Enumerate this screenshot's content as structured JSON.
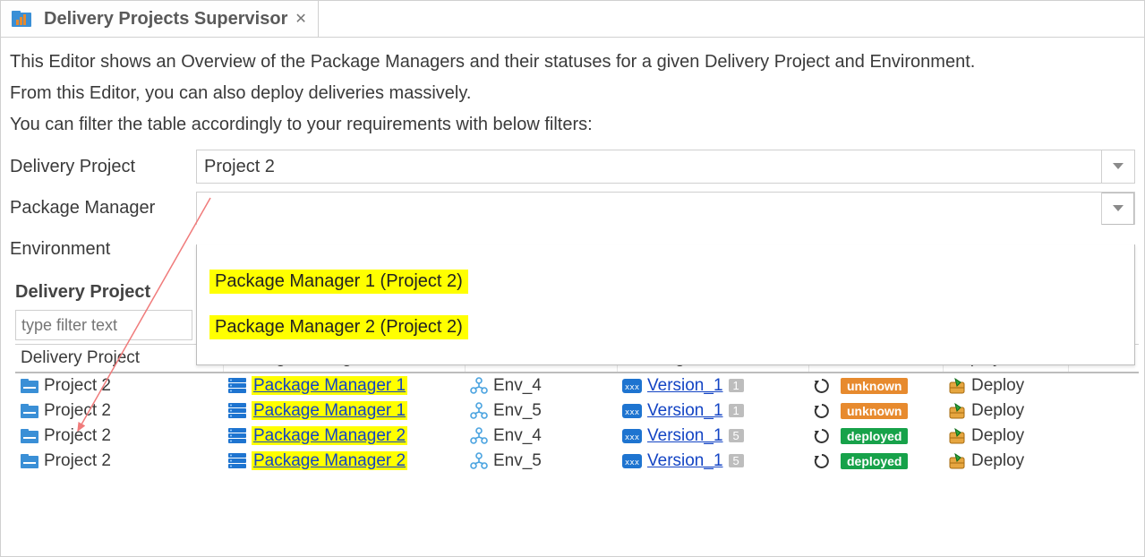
{
  "tab": {
    "title": "Delivery Projects Supervisor"
  },
  "intro": {
    "line1": "This Editor shows an Overview of the Package Managers and their statuses for a given Delivery Project and Environment.",
    "line2": "From this Editor, you can also deploy deliveries massively.",
    "line3": "You can filter the table accordingly to your requirements with below filters:"
  },
  "filters": {
    "delivery_project": {
      "label": "Delivery Project",
      "value": "Project 2"
    },
    "package_manager": {
      "label": "Package Manager",
      "value": ""
    },
    "environment": {
      "label": "Environment",
      "value": ""
    }
  },
  "dropdown": {
    "options": [
      "Package Manager 1 (Project 2)",
      "Package Manager 2 (Project 2)"
    ]
  },
  "section_header": "Delivery Project",
  "filter_placeholder": "type filter text",
  "columns": {
    "c1": "Delivery Project",
    "c2": "Package Manager",
    "c3": "Environment",
    "c4": "Working Version",
    "c5": "Status",
    "c6": "Deploy"
  },
  "status_labels": {
    "unknown": "unknown",
    "deployed": "deployed"
  },
  "deploy_label": "Deploy",
  "rows": [
    {
      "project": "Project 2",
      "pkg": "Package Manager 1",
      "env": "Env_4",
      "version": "Version_1",
      "vcount": "1",
      "status": "unknown"
    },
    {
      "project": "Project 2",
      "pkg": "Package Manager 1",
      "env": "Env_5",
      "version": "Version_1",
      "vcount": "1",
      "status": "unknown"
    },
    {
      "project": "Project 2",
      "pkg": "Package Manager 2",
      "env": "Env_4",
      "version": "Version_1",
      "vcount": "5",
      "status": "deployed"
    },
    {
      "project": "Project 2",
      "pkg": "Package Manager 2",
      "env": "Env_5",
      "version": "Version_1",
      "vcount": "5",
      "status": "deployed"
    }
  ]
}
